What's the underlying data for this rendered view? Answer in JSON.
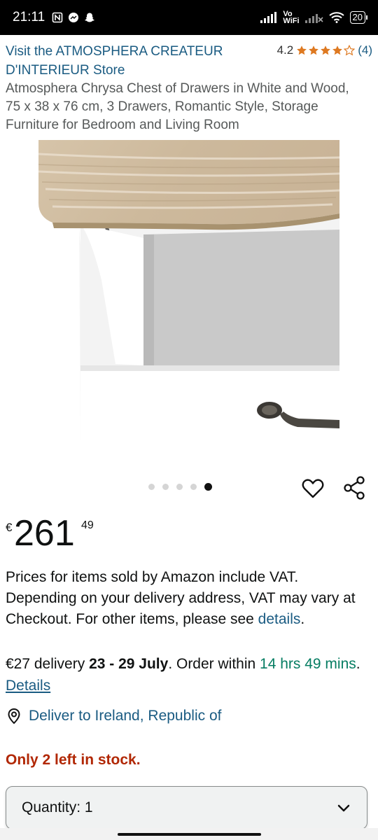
{
  "status_bar": {
    "time": "21:11",
    "left_icons": [
      "nfc-icon",
      "messenger-icon",
      "snapchat-icon"
    ],
    "vo_wifi_top": "Vo",
    "vo_wifi_bottom": "WiFi",
    "battery": "20"
  },
  "store": {
    "link": "Visit the ATMOSPHERA CREATEUR D'INTERIEUR Store",
    "rating_value": "4.2",
    "rating_count": "(4)",
    "stars": 4.2
  },
  "product": {
    "title": "Atmosphera Chrysa Chest of Drawers in White and Wood, 75 x 38 x 76 cm, 3 Drawers, Romantic Style, Storage Furniture for Bedroom and Living Room"
  },
  "carousel": {
    "total": 5,
    "active_index": 4
  },
  "price": {
    "symbol": "€",
    "whole": "261",
    "fraction": "49"
  },
  "vat": {
    "text": "Prices for items sold by Amazon include VAT. Depending on your delivery address, VAT may vary at Checkout. For other items, please see ",
    "link": "details",
    "end": "."
  },
  "delivery": {
    "prefix": "€27 delivery ",
    "dates": "23 - 29 July",
    "middle": ". Order within ",
    "countdown": "14 hrs 49 mins",
    "sep": ". ",
    "details_link": "Details"
  },
  "deliver_to": "Deliver to Ireland, Republic of",
  "stock": "Only 2 left in stock.",
  "quantity": {
    "label": "Quantity: 1"
  },
  "colors": {
    "link": "#1a5b82",
    "stars": "#de7921",
    "stock": "#b12704",
    "countdown": "#067d62"
  }
}
